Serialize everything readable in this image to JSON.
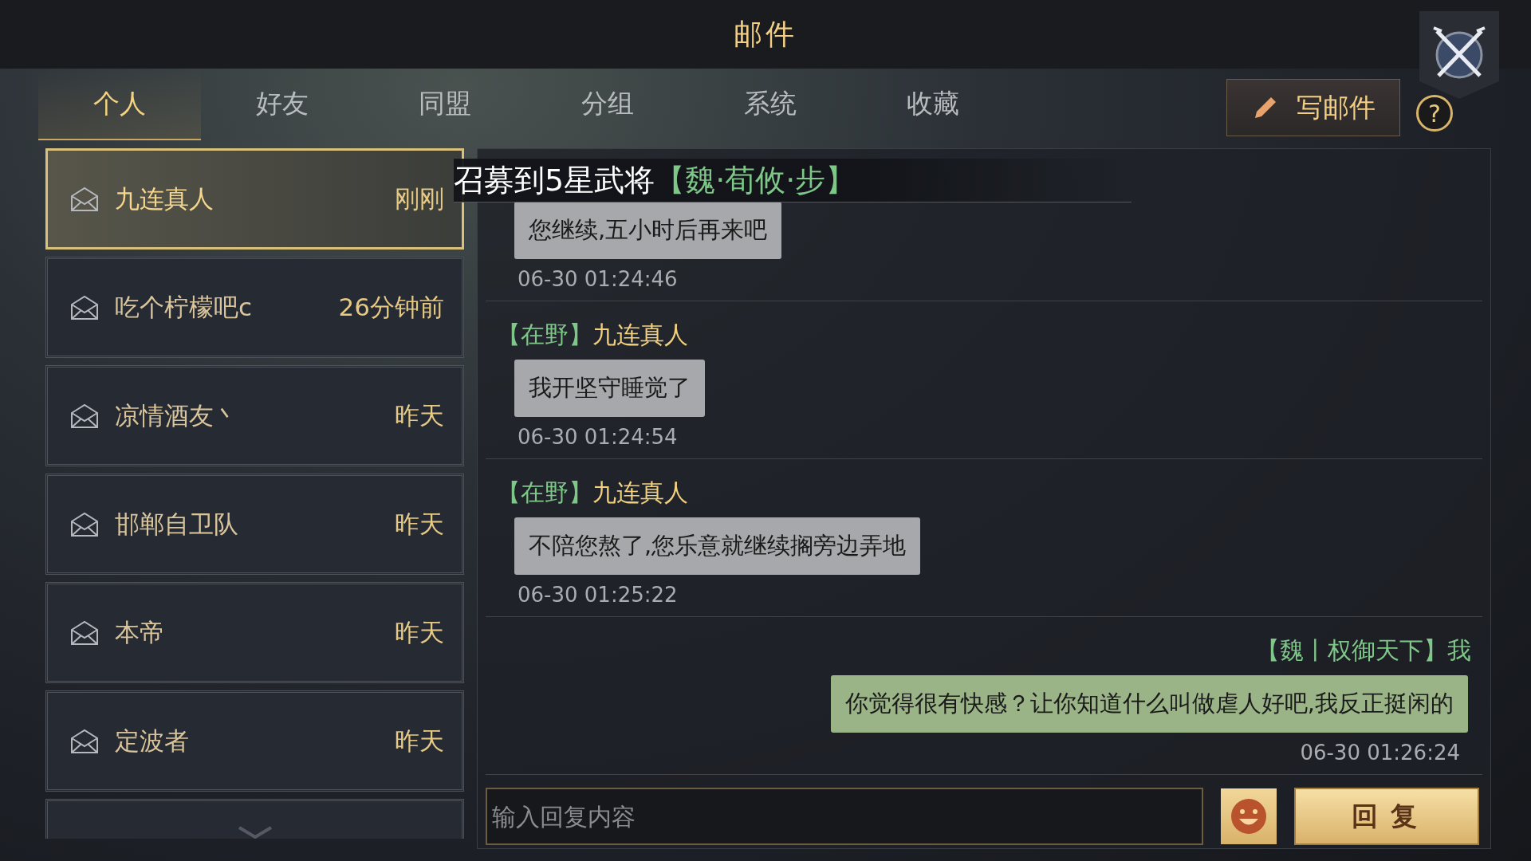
{
  "title": "邮件",
  "tabs": [
    {
      "label": "个人",
      "selected": true
    },
    {
      "label": "好友",
      "selected": false
    },
    {
      "label": "同盟",
      "selected": false
    },
    {
      "label": "分组",
      "selected": false
    },
    {
      "label": "系统",
      "selected": false
    },
    {
      "label": "收藏",
      "selected": false
    }
  ],
  "compose_button": "写邮件",
  "help_button": "?",
  "mail_list": [
    {
      "sender": "九连真人",
      "time": "刚刚",
      "selected": true
    },
    {
      "sender": "吃个柠檬吧c",
      "time": "26分钟前",
      "selected": false
    },
    {
      "sender": "凉情酒友丶",
      "time": "昨天",
      "selected": false
    },
    {
      "sender": "邯郸自卫队",
      "time": "昨天",
      "selected": false
    },
    {
      "sender": "本帝",
      "time": "昨天",
      "selected": false
    },
    {
      "sender": "定波者",
      "time": "昨天",
      "selected": false
    }
  ],
  "banner": {
    "text": "召募到5星武将",
    "highlight": "【魏·荀攸·步】"
  },
  "messages": [
    {
      "kind": "incoming",
      "text": "您继续,五小时后再来吧",
      "time": "06-30 01:24:46"
    },
    {
      "kind": "incoming",
      "tag": "【在野】",
      "sender": "九连真人",
      "text": "我开坚守睡觉了",
      "time": "06-30 01:24:54"
    },
    {
      "kind": "incoming",
      "tag": "【在野】",
      "sender": "九连真人",
      "text": "不陪您熬了,您乐意就继续搁旁边弄地",
      "time": "06-30 01:25:22"
    },
    {
      "kind": "outgoing",
      "tag": "【魏丨权御天下】",
      "sender": "我",
      "text": "你觉得很有快感？让你知道什么叫做虐人好吧,我反正挺闲的",
      "time": "06-30 01:26:24"
    }
  ],
  "reply_input": {
    "placeholder": "输入回复内容"
  },
  "reply_button": "回复"
}
